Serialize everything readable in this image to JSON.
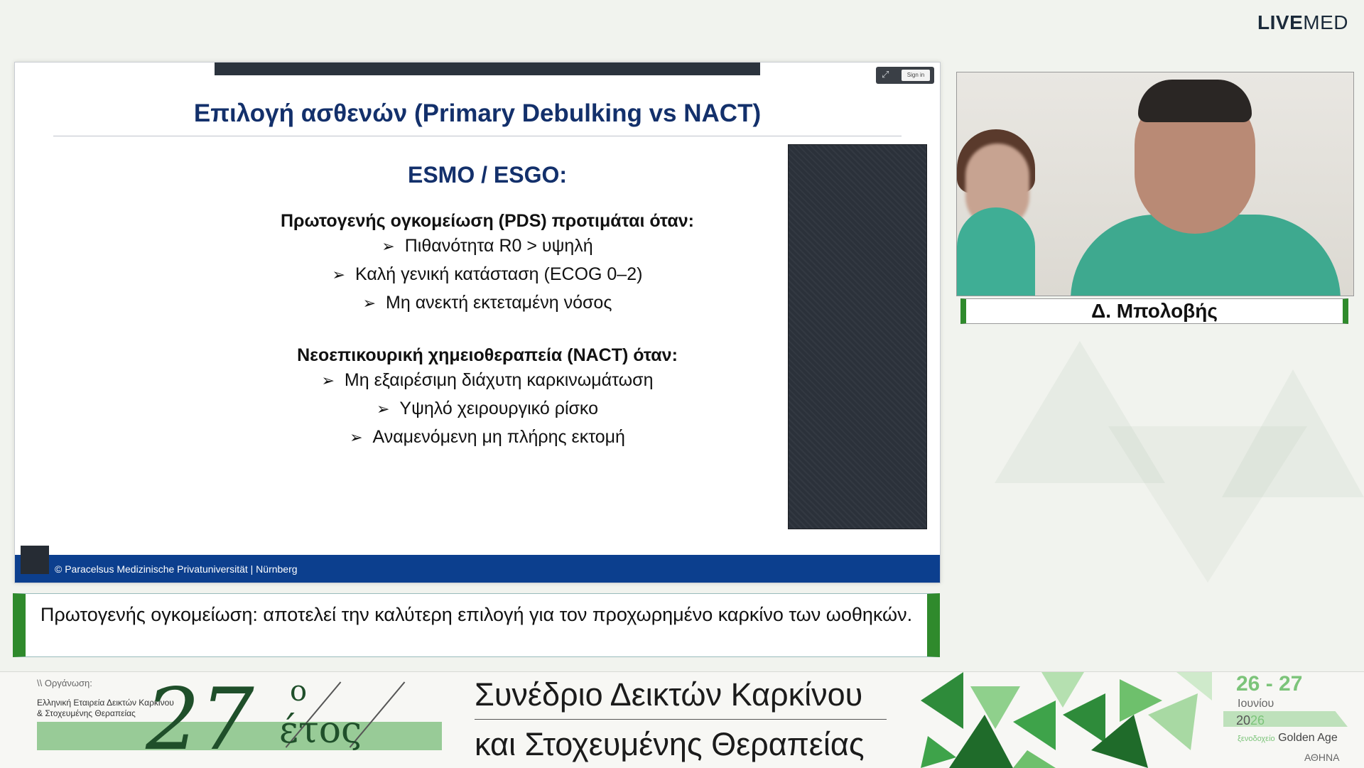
{
  "brand": {
    "part1": "LIVE",
    "part2": "MED"
  },
  "viewer": {
    "sign_in": "Sign in",
    "expand_icon": "expand-icon"
  },
  "slide": {
    "title": "Επιλογή ασθενών (Primary Debulking vs NACT)",
    "heading": "ESMO / ESGO:",
    "section1": {
      "title": "Πρωτογενής ογκομείωση (PDS) προτιμάται όταν:",
      "items": [
        "Πιθανότητα R0 > υψηλή",
        "Καλή γενική κατάσταση (ECOG 0–2)",
        "Μη ανεκτή εκτεταμένη νόσος"
      ]
    },
    "section2": {
      "title": "Νεοεπικουρική χημειοθεραπεία (NACT) όταν:",
      "items": [
        "Μη εξαιρέσιμη διάχυτη καρκινωμάτωση",
        "Υψηλό χειρουργικό ρίσκο",
        "Αναμενόμενη μη πλήρης εκτομή"
      ]
    },
    "bullet_glyph": "➢",
    "footer": "© Paracelsus Medizinische Privatuniversität | Nürnberg"
  },
  "caption": {
    "text": "Πρωτογενής ογκομείωση: αποτελεί την καλύτερη επιλογή για τον προχωρημένο καρκίνο των ωοθηκών."
  },
  "speaker": {
    "name": "Δ. Μπολοβής"
  },
  "banner": {
    "org_label": "\\\\ Οργάνωση:",
    "org_line1": "Ελληνική Εταιρεία Δεικτών Καρκίνου",
    "org_line2": "& Στοχευμένης Θεραπείας",
    "number": "27",
    "superscript": "ο",
    "etos": "έτος",
    "title_line1": "Συνέδριο Δεικτών Καρκίνου",
    "title_line2": "και Στοχευμένης Θεραπείας",
    "date_days": "26 - 27",
    "date_month": "Ιουνίου",
    "date_year_a": "20",
    "date_year_b": "26",
    "hotel_prefix": "ξενοδοχείο",
    "hotel_name": "Golden Age",
    "city": "ΑΘΗΝΑ"
  },
  "colors": {
    "slide_title": "#13306b",
    "footer_blue": "#0c3f8e",
    "accent_green": "#2f8a2c",
    "banner_green": "#7cc47a"
  }
}
